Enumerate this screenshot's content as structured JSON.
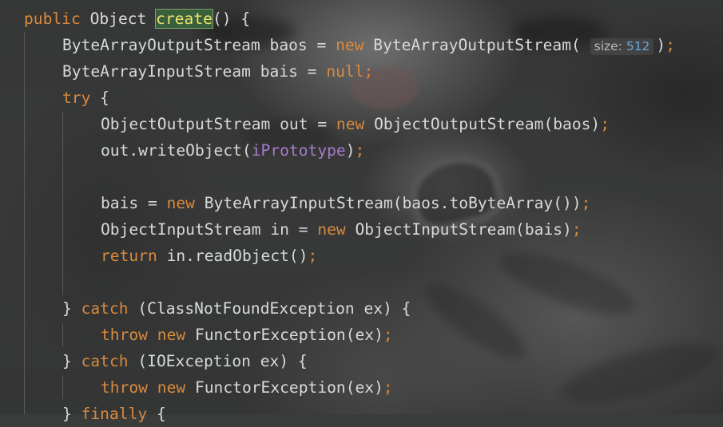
{
  "editor": {
    "lines": [
      {
        "indent": 30,
        "tokens": [
          {
            "t": "public",
            "c": "kw"
          },
          {
            "t": " Object ",
            "c": "id"
          },
          {
            "t": "create",
            "c": "hl"
          },
          {
            "t": "() {",
            "c": "punct"
          }
        ]
      },
      {
        "indent": 78,
        "tokens": [
          {
            "t": "ByteArrayOutputStream baos = ",
            "c": "id"
          },
          {
            "t": "new",
            "c": "kw"
          },
          {
            "t": " ByteArrayOutputStream( ",
            "c": "id"
          },
          {
            "t": "size:",
            "c": "hint-label"
          },
          {
            "t": "512",
            "c": "hint-value"
          },
          {
            "t": ")",
            "c": "punct"
          },
          {
            "t": ";",
            "c": "semi"
          }
        ]
      },
      {
        "indent": 78,
        "tokens": [
          {
            "t": "ByteArrayInputStream bais = ",
            "c": "id"
          },
          {
            "t": "null",
            "c": "kw"
          },
          {
            "t": ";",
            "c": "semi"
          }
        ]
      },
      {
        "indent": 78,
        "tokens": [
          {
            "t": "try",
            "c": "kw"
          },
          {
            "t": " {",
            "c": "punct"
          }
        ]
      },
      {
        "indent": 126,
        "tokens": [
          {
            "t": "ObjectOutputStream out = ",
            "c": "id"
          },
          {
            "t": "new",
            "c": "kw"
          },
          {
            "t": " ObjectOutputStream(baos)",
            "c": "id"
          },
          {
            "t": ";",
            "c": "semi"
          }
        ]
      },
      {
        "indent": 126,
        "tokens": [
          {
            "t": "out.writeObject(",
            "c": "id"
          },
          {
            "t": "iPrototype",
            "c": "field"
          },
          {
            "t": ")",
            "c": "punct"
          },
          {
            "t": ";",
            "c": "semi"
          }
        ]
      },
      {
        "indent": 126,
        "tokens": []
      },
      {
        "indent": 126,
        "tokens": [
          {
            "t": "bais = ",
            "c": "id"
          },
          {
            "t": "new",
            "c": "kw"
          },
          {
            "t": " ByteArrayInputStream(baos.toByteArray())",
            "c": "id"
          },
          {
            "t": ";",
            "c": "semi"
          }
        ]
      },
      {
        "indent": 126,
        "tokens": [
          {
            "t": "ObjectInputStream in = ",
            "c": "id"
          },
          {
            "t": "new",
            "c": "kw"
          },
          {
            "t": " ObjectInputStream(bais)",
            "c": "id"
          },
          {
            "t": ";",
            "c": "semi"
          }
        ]
      },
      {
        "indent": 126,
        "tokens": [
          {
            "t": "return",
            "c": "kw"
          },
          {
            "t": " in.readObject()",
            "c": "id"
          },
          {
            "t": ";",
            "c": "semi"
          }
        ]
      },
      {
        "indent": 126,
        "tokens": []
      },
      {
        "indent": 78,
        "tokens": [
          {
            "t": "} ",
            "c": "punct"
          },
          {
            "t": "catch",
            "c": "kw"
          },
          {
            "t": " (ClassNotFoundException ex) {",
            "c": "id"
          }
        ]
      },
      {
        "indent": 126,
        "tokens": [
          {
            "t": "throw",
            "c": "kw"
          },
          {
            "t": " ",
            "c": "id"
          },
          {
            "t": "new",
            "c": "kw"
          },
          {
            "t": " FunctorException(ex)",
            "c": "id"
          },
          {
            "t": ";",
            "c": "semi"
          }
        ]
      },
      {
        "indent": 78,
        "tokens": [
          {
            "t": "} ",
            "c": "punct"
          },
          {
            "t": "catch",
            "c": "kw"
          },
          {
            "t": " (IOException ex) {",
            "c": "id"
          }
        ]
      },
      {
        "indent": 126,
        "tokens": [
          {
            "t": "throw",
            "c": "kw"
          },
          {
            "t": " ",
            "c": "id"
          },
          {
            "t": "new",
            "c": "kw"
          },
          {
            "t": " FunctorException(ex)",
            "c": "id"
          },
          {
            "t": ";",
            "c": "semi"
          }
        ]
      },
      {
        "indent": 78,
        "tokens": [
          {
            "t": "} ",
            "c": "punct"
          },
          {
            "t": "finally",
            "c": "kw"
          },
          {
            "t": " {",
            "c": "punct"
          }
        ]
      }
    ]
  },
  "colors": {
    "keyword": "#d88a3e",
    "identifier": "#d7d9dc",
    "field": "#a67bc9",
    "number": "#5fa9d6",
    "highlight": "#39603c"
  }
}
